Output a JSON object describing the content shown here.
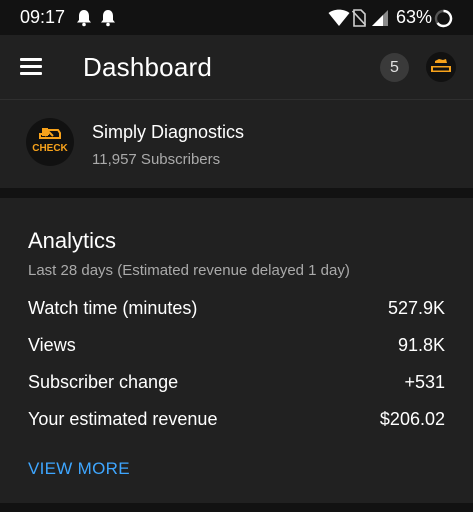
{
  "status_bar": {
    "time": "09:17",
    "battery_percent": "63%",
    "icons": [
      "bell-icon",
      "bell-icon",
      "wifi-icon",
      "no-sim-icon",
      "signal-icon",
      "battery-ring-icon"
    ]
  },
  "app_bar": {
    "title": "Dashboard",
    "notification_count": "5"
  },
  "channel": {
    "name": "Simply Diagnostics",
    "subscribers": "11,957 Subscribers",
    "avatar_text": "CHECK"
  },
  "analytics": {
    "title": "Analytics",
    "subtitle": "Last 28 days (Estimated revenue delayed 1 day)",
    "metrics": [
      {
        "label": "Watch time (minutes)",
        "value": "527.9K"
      },
      {
        "label": "Views",
        "value": "91.8K"
      },
      {
        "label": "Subscriber change",
        "value": "+531"
      },
      {
        "label": "Your estimated revenue",
        "value": "$206.02"
      }
    ],
    "view_more": "VIEW MORE"
  },
  "colors": {
    "background": "#181818",
    "card": "#212121",
    "accent_link": "#3ea6ff",
    "secondary_text": "#aaaaaa",
    "logo_orange": "#f7a21b"
  }
}
